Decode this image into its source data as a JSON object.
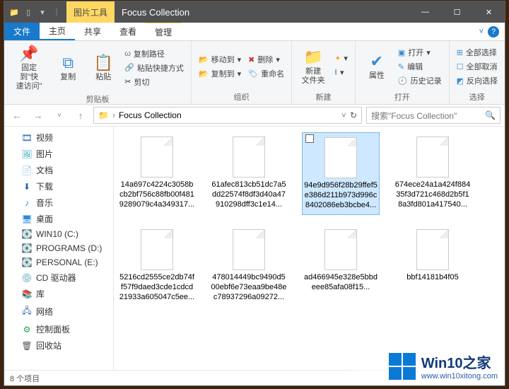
{
  "titlebar": {
    "tool_tab": "图片工具",
    "title": "Focus Collection"
  },
  "tabs": {
    "file": "文件",
    "home": "主页",
    "share": "共享",
    "view": "查看",
    "manage": "管理"
  },
  "ribbon": {
    "pin": "固定到\"快\n速访问\"",
    "copy": "复制",
    "paste": "粘贴",
    "copy_path": "复制路径",
    "paste_shortcut": "粘贴快捷方式",
    "cut": "剪切",
    "group_clipboard": "剪贴板",
    "move_to": "移动到",
    "copy_to": "复制到",
    "delete": "删除",
    "rename": "重命名",
    "group_organize": "组织",
    "new_folder": "新建\n文件夹",
    "group_new": "新建",
    "properties": "属性",
    "open": "打开",
    "edit": "编辑",
    "history": "历史记录",
    "group_open": "打开",
    "select_all": "全部选择",
    "select_none": "全部取消",
    "invert": "反向选择",
    "group_select": "选择"
  },
  "address": {
    "folder": "Focus Collection",
    "search_placeholder": "搜索\"Focus Collection\""
  },
  "nav": [
    {
      "icon": "🎞",
      "label": "视频",
      "color": "#2168b0"
    },
    {
      "icon": "🖼",
      "label": "图片",
      "color": "#2aa6b7"
    },
    {
      "icon": "📄",
      "label": "文档",
      "color": "#4b7ab2"
    },
    {
      "icon": "⬇",
      "label": "下载",
      "color": "#2168b0"
    },
    {
      "icon": "♪",
      "label": "音乐",
      "color": "#1f88d2"
    },
    {
      "icon": "🖥",
      "label": "桌面",
      "color": "#2a88d8"
    },
    {
      "icon": "💽",
      "label": "WIN10 (C:)",
      "color": "#777"
    },
    {
      "icon": "💽",
      "label": "PROGRAMS (D:)",
      "color": "#777"
    },
    {
      "icon": "💽",
      "label": "PERSONAL (E:)",
      "color": "#777"
    },
    {
      "icon": "💿",
      "label": "CD 驱动器",
      "color": "#777"
    },
    {
      "icon": "📚",
      "label": "库",
      "color": "#3a95d4"
    },
    {
      "icon": "🖧",
      "label": "网络",
      "color": "#3a6da8"
    },
    {
      "icon": "⚙",
      "label": "控制面板",
      "color": "#2aa15a"
    },
    {
      "icon": "🗑",
      "label": "回收站",
      "color": "#555"
    }
  ],
  "files": {
    "row1": [
      {
        "name": "14a697c4224c3058bcb2bf756c88fb00f4819289079c4a349317...",
        "selected": false
      },
      {
        "name": "61afec813cb51dc7a5dd22574f8df3d40a47910298dff3c1e14...",
        "selected": false
      },
      {
        "name": "94e9d956f28b29ffef5e386d211b973d996c8402086eb3bcbe4...",
        "selected": true
      },
      {
        "name": "674ece24a1a424f88435f3d721c468d2b5f18a3fd801a417540...",
        "selected": false
      }
    ],
    "row2": [
      {
        "name": "5216cd2555ce2db74ff57f9daed3cde1cdcd21933a605047c5ee...",
        "selected": false
      },
      {
        "name": "478014449bc9490d500ebf6e73eaa9be48ec78937296a09272...",
        "selected": false
      },
      {
        "name": "ad466945e328e5bbdeee85afa08f15...",
        "selected": false
      },
      {
        "name": "bbf14181b4f05",
        "selected": false
      }
    ]
  },
  "status": {
    "text": "8 个项目"
  },
  "watermark": {
    "title": "Win10之家",
    "url": "www.win10xitong.com"
  }
}
